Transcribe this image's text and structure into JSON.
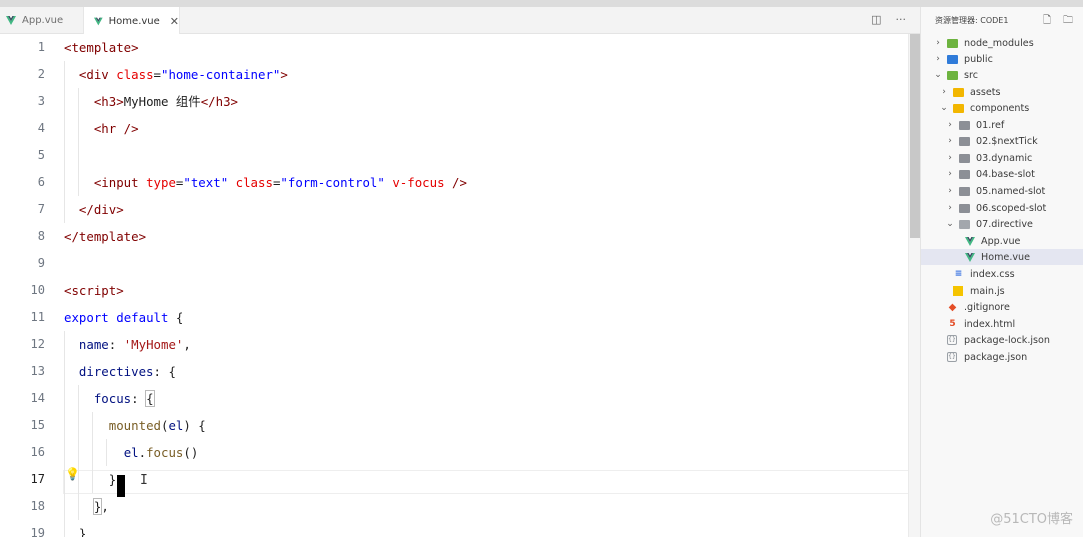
{
  "tabs": [
    {
      "label": "App.vue",
      "icon": "vue-icon",
      "active": false
    },
    {
      "label": "Home.vue",
      "icon": "vue-icon",
      "active": true,
      "close": "✕"
    }
  ],
  "editor_actions": {
    "split": "◫",
    "more": "···"
  },
  "code": {
    "line_numbers": [
      "1",
      "2",
      "3",
      "4",
      "5",
      "6",
      "7",
      "8",
      "9",
      "10",
      "11",
      "12",
      "13",
      "14",
      "15",
      "16",
      "17",
      "18",
      "19"
    ],
    "current_line": "17"
  },
  "explorer": {
    "title": "资源管理器: CODE1",
    "actions": {
      "new_file": "🗋",
      "new_folder": "🗀"
    },
    "items": [
      {
        "label": "node_modules",
        "kind": "folder-green",
        "chevron": "›"
      },
      {
        "label": "public",
        "kind": "folder-blue",
        "chevron": "›"
      },
      {
        "label": "src",
        "kind": "folder-green",
        "chevron": "⌄"
      },
      {
        "label": "assets",
        "kind": "folder-yellow",
        "chevron": "›"
      },
      {
        "label": "components",
        "kind": "folder-yellow",
        "chevron": "⌄"
      },
      {
        "label": "01.ref",
        "kind": "folder",
        "chevron": "›"
      },
      {
        "label": "02.$nextTick",
        "kind": "folder",
        "chevron": "›"
      },
      {
        "label": "03.dynamic",
        "kind": "folder",
        "chevron": "›"
      },
      {
        "label": "04.base-slot",
        "kind": "folder",
        "chevron": "›"
      },
      {
        "label": "05.named-slot",
        "kind": "folder",
        "chevron": "›"
      },
      {
        "label": "06.scoped-slot",
        "kind": "folder",
        "chevron": "›"
      },
      {
        "label": "07.directive",
        "kind": "folder-open",
        "chevron": "⌄"
      },
      {
        "label": "App.vue",
        "kind": "vue"
      },
      {
        "label": "Home.vue",
        "kind": "vue",
        "selected": true
      },
      {
        "label": "index.css",
        "kind": "css"
      },
      {
        "label": "main.js",
        "kind": "js"
      },
      {
        "label": ".gitignore",
        "kind": "git"
      },
      {
        "label": "index.html",
        "kind": "html"
      },
      {
        "label": "package-lock.json",
        "kind": "json"
      },
      {
        "label": "package.json",
        "kind": "json"
      }
    ]
  },
  "watermark": "@51CTO博客",
  "colors": {
    "tag": "#800000",
    "attr": "#e50000",
    "string": "#0000ff",
    "keyword": "#0000ff",
    "property": "#001080",
    "function": "#795e26",
    "value": "#a31515",
    "vue_green": "#41b883"
  }
}
